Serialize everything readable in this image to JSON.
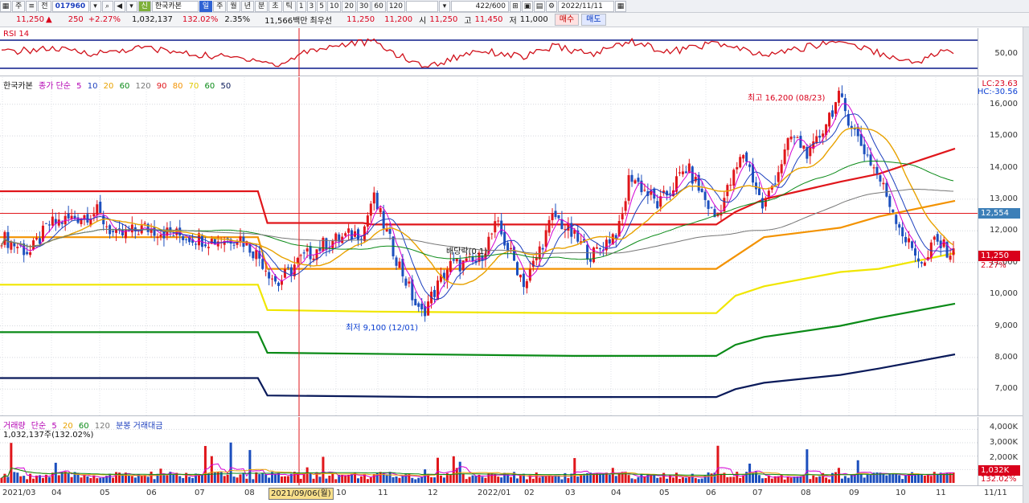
{
  "toolbar": {
    "icons": [
      "grid-icon",
      "menu-icon",
      "lock-icon",
      "search-icon",
      "speaker-icon",
      "settings-icon",
      "save-icon"
    ],
    "main_label": "주",
    "mode_label": "전",
    "code": "017960",
    "sin_label": "신",
    "stock_name": "한국카본",
    "period_tabs": [
      "일",
      "주",
      "월",
      "년",
      "분",
      "초",
      "틱"
    ],
    "minute_options": [
      "1",
      "3",
      "5",
      "10",
      "20",
      "30",
      "60",
      "120"
    ],
    "count": "422/600",
    "date": "2022/11/11"
  },
  "quote": {
    "price": "11,250",
    "arrow": "▲",
    "change": "250",
    "change_pct": "+2.27%",
    "volume": "1,032,137",
    "vol_ratio": "132.02%",
    "turnover": "2.35%",
    "amount": "11,566백만",
    "priority_label": "최우선",
    "bid1": "11,250",
    "bid2": "11,200",
    "open_label": "시",
    "open": "11,250",
    "high_label": "고",
    "high": "11,450",
    "low_label": "저",
    "low": "11,000",
    "buy_label": "매수",
    "sell_label": "매도"
  },
  "rsi_pane": {
    "title": "RSI 14",
    "axis": [
      "50,00"
    ]
  },
  "price_pane": {
    "legend": [
      "한국카본",
      "종가 단순",
      "5",
      "10",
      "20",
      "60",
      "120",
      "90",
      "80",
      "70",
      "60",
      "50"
    ],
    "axis": [
      "16,000",
      "15,000",
      "14,000",
      "13,000",
      "12,000",
      "11,000",
      "10,000",
      "9,000",
      "8,000",
      "7,000"
    ],
    "lc": "LC:23.63",
    "hc": "HC:-30.56",
    "tag_line": "12,554",
    "tag_price": "11,250",
    "tag_pct": "2.27%",
    "max_note": "최고 16,200 (08/23)",
    "min_note": "최저 9,100 (12/01)",
    "dividend_note": "배당락(0.1)"
  },
  "volume_pane": {
    "legend": [
      "거래량",
      "단순",
      "5",
      "20",
      "60",
      "120",
      "분봉 거래대금"
    ],
    "subtitle": "1,032,137주(132.02%)",
    "axis": [
      "4,000K",
      "3,000K",
      "2,000K",
      "1,000K"
    ],
    "tag_vol": "1,032K",
    "tag_pct": "132.02%"
  },
  "date_axis": {
    "labels": [
      "2021/03",
      "04",
      "05",
      "06",
      "07",
      "08",
      "10",
      "11",
      "12",
      "2022/01",
      "02",
      "03",
      "04",
      "05",
      "06",
      "07",
      "08",
      "09",
      "10",
      "11"
    ],
    "cursor": "2021/09/06(월)",
    "right_label": "11/11"
  },
  "chart_data": {
    "type": "candlestick",
    "ylim": [
      6500,
      16500
    ],
    "reference_lines": [
      12554
    ],
    "envelope_levels": [
      {
        "name": "90",
        "color": "#e0161b",
        "points": [
          [
            0,
            13250
          ],
          [
            0.27,
            13250
          ],
          [
            0.28,
            12250
          ],
          [
            0.38,
            12250
          ],
          [
            0.39,
            12200
          ],
          [
            0.6,
            12200
          ],
          [
            0.7,
            12200
          ],
          [
            0.75,
            12200
          ],
          [
            0.77,
            12600
          ],
          [
            0.8,
            13000
          ],
          [
            0.88,
            13550
          ],
          [
            0.92,
            13800
          ],
          [
            1,
            14600
          ]
        ]
      },
      {
        "name": "80",
        "color": "#f39200",
        "points": [
          [
            0,
            11800
          ],
          [
            0.27,
            11800
          ],
          [
            0.28,
            10800
          ],
          [
            0.6,
            10800
          ],
          [
            0.75,
            10800
          ],
          [
            0.77,
            11200
          ],
          [
            0.8,
            11800
          ],
          [
            0.88,
            12100
          ],
          [
            0.92,
            12450
          ],
          [
            1,
            12950
          ]
        ]
      },
      {
        "name": "70",
        "color": "#f0e600",
        "points": [
          [
            0,
            10300
          ],
          [
            0.27,
            10300
          ],
          [
            0.28,
            9500
          ],
          [
            0.39,
            9450
          ],
          [
            0.6,
            9400
          ],
          [
            0.75,
            9400
          ],
          [
            0.77,
            9950
          ],
          [
            0.8,
            10250
          ],
          [
            0.88,
            10700
          ],
          [
            0.92,
            10800
          ],
          [
            1,
            11300
          ]
        ]
      },
      {
        "name": "60",
        "color": "#0a8a17",
        "points": [
          [
            0,
            8800
          ],
          [
            0.27,
            8800
          ],
          [
            0.28,
            8150
          ],
          [
            0.6,
            8050
          ],
          [
            0.75,
            8050
          ],
          [
            0.77,
            8400
          ],
          [
            0.8,
            8650
          ],
          [
            0.88,
            9000
          ],
          [
            0.92,
            9250
          ],
          [
            1,
            9700
          ]
        ]
      },
      {
        "name": "50",
        "color": "#0a1a5a",
        "points": [
          [
            0,
            7350
          ],
          [
            0.27,
            7350
          ],
          [
            0.28,
            6800
          ],
          [
            0.45,
            6750
          ],
          [
            0.75,
            6750
          ],
          [
            0.77,
            7000
          ],
          [
            0.8,
            7200
          ],
          [
            0.88,
            7450
          ],
          [
            0.92,
            7650
          ],
          [
            1,
            8100
          ]
        ]
      }
    ],
    "close_series": [
      [
        0,
        11800
      ],
      [
        0.03,
        11300
      ],
      [
        0.05,
        12200
      ],
      [
        0.1,
        12600
      ],
      [
        0.12,
        11800
      ],
      [
        0.15,
        12100
      ],
      [
        0.18,
        11900
      ],
      [
        0.22,
        11700
      ],
      [
        0.25,
        11800
      ],
      [
        0.27,
        11200
      ],
      [
        0.29,
        10300
      ],
      [
        0.31,
        11000
      ],
      [
        0.34,
        11600
      ],
      [
        0.38,
        12000
      ],
      [
        0.39,
        13100
      ],
      [
        0.41,
        11500
      ],
      [
        0.44,
        9300
      ],
      [
        0.47,
        10900
      ],
      [
        0.5,
        11000
      ],
      [
        0.52,
        12200
      ],
      [
        0.55,
        10300
      ],
      [
        0.58,
        12500
      ],
      [
        0.62,
        11200
      ],
      [
        0.65,
        12100
      ],
      [
        0.66,
        13800
      ],
      [
        0.69,
        12800
      ],
      [
        0.72,
        14000
      ],
      [
        0.75,
        12400
      ],
      [
        0.78,
        14500
      ],
      [
        0.8,
        12700
      ],
      [
        0.83,
        15000
      ],
      [
        0.85,
        14400
      ],
      [
        0.87,
        15700
      ],
      [
        0.88,
        16200
      ],
      [
        0.9,
        14900
      ],
      [
        0.92,
        13800
      ],
      [
        0.95,
        11700
      ],
      [
        0.97,
        10900
      ],
      [
        0.98,
        11700
      ],
      [
        1,
        11250
      ]
    ],
    "rsi_series": [
      [
        0,
        50
      ],
      [
        0.05,
        53
      ],
      [
        0.1,
        49
      ],
      [
        0.15,
        54
      ],
      [
        0.2,
        48
      ],
      [
        0.27,
        44
      ],
      [
        0.29,
        38
      ],
      [
        0.32,
        51
      ],
      [
        0.36,
        57
      ],
      [
        0.39,
        59
      ],
      [
        0.43,
        42
      ],
      [
        0.45,
        38
      ],
      [
        0.5,
        52
      ],
      [
        0.55,
        46
      ],
      [
        0.58,
        55
      ],
      [
        0.62,
        48
      ],
      [
        0.66,
        60
      ],
      [
        0.7,
        50
      ],
      [
        0.75,
        58
      ],
      [
        0.8,
        47
      ],
      [
        0.85,
        55
      ],
      [
        0.88,
        60
      ],
      [
        0.92,
        50
      ],
      [
        0.95,
        42
      ],
      [
        0.97,
        44
      ],
      [
        0.99,
        52
      ],
      [
        1,
        48
      ]
    ],
    "volume_ticks": [
      1000,
      2000,
      3000,
      4000
    ]
  }
}
